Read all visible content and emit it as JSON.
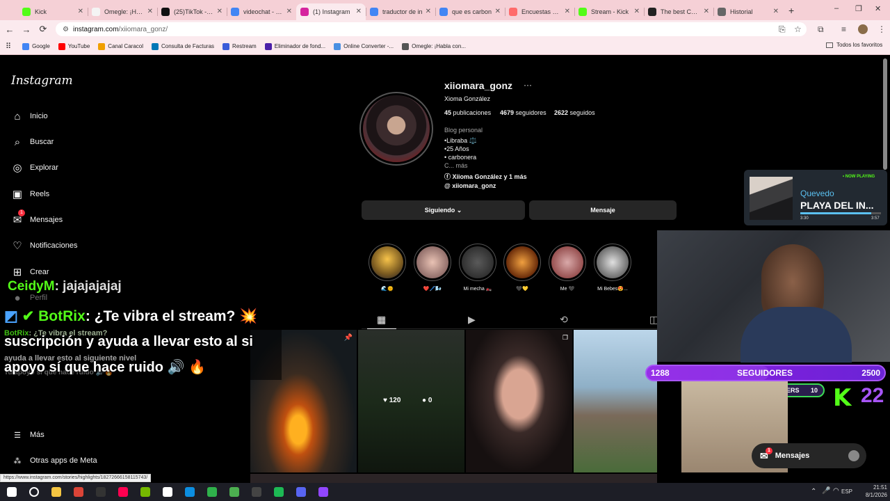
{
  "browser": {
    "tabs": [
      {
        "title": "Kick",
        "color": "#53fc18"
      },
      {
        "title": "Omegle: ¡Habla con",
        "color": "#f4f4f4"
      },
      {
        "title": "(25)TikTok - Ma",
        "color": "#111111"
      },
      {
        "title": "videochat - Bus",
        "color": "#4285f4"
      },
      {
        "title": "(1) Instagram",
        "color": "#d6249f",
        "active": true
      },
      {
        "title": "traductor de in",
        "color": "#4285f4"
      },
      {
        "title": "que es carbon",
        "color": "#4285f4"
      },
      {
        "title": "Encuestas en li",
        "color": "#ff6b6b"
      },
      {
        "title": "Stream - Kick",
        "color": "#53fc18"
      },
      {
        "title": "The best Chatb",
        "color": "#222222"
      },
      {
        "title": "Historial",
        "color": "#666666"
      }
    ],
    "new_tab": "+",
    "url_host": "instagram.com",
    "url_path": "/xiiomara_gonz/",
    "bookmarks": [
      {
        "label": "Google",
        "color": "#4285f4"
      },
      {
        "label": "YouTube",
        "color": "#ff0000"
      },
      {
        "label": "Canal Caracol",
        "color": "#f0a000"
      },
      {
        "label": "Consulta de Facturas",
        "color": "#0077b6"
      },
      {
        "label": "Restream",
        "color": "#3a5bd9"
      },
      {
        "label": "Eliminador de fond...",
        "color": "#4b1fa8"
      },
      {
        "label": "Online Converter -...",
        "color": "#4a90e2"
      },
      {
        "label": "Omegle: ¡Habla con...",
        "color": "#555555"
      }
    ],
    "all_bookmarks": "Todos los favoritos"
  },
  "instagram": {
    "logo": "Instagram",
    "nav": [
      {
        "label": "Inicio",
        "icon": "home-icon"
      },
      {
        "label": "Buscar",
        "icon": "search-icon"
      },
      {
        "label": "Explorar",
        "icon": "explore-icon"
      },
      {
        "label": "Reels",
        "icon": "reels-icon"
      },
      {
        "label": "Mensajes",
        "icon": "messenger-icon",
        "badge": "1"
      },
      {
        "label": "Notificaciones",
        "icon": "heart-icon"
      },
      {
        "label": "Crear",
        "icon": "plus-square-icon"
      },
      {
        "label": "Perfil",
        "icon": "avatar-icon"
      }
    ],
    "more": "Más",
    "meta": "Otras apps de Meta",
    "profile": {
      "username": "xiiomara_gonz",
      "full_name": "Xioma González",
      "posts_count": "45",
      "posts_label": "publicaciones",
      "followers_count": "4679",
      "followers_label": "seguidores",
      "following_count": "2622",
      "following_label": "seguidos",
      "category": "Blog personal",
      "bio": [
        "•Libraba ⚖️",
        "•25 Años",
        "• carbonera",
        "C... más"
      ],
      "link_facebook": "Xiioma González y 1 más",
      "link_threads": "xiiomara_gonz",
      "following_button": "Siguiendo",
      "message_button": "Mensaje"
    },
    "highlights": [
      {
        "label": "🌊🌞",
        "bg": "radial-gradient(circle at 50% 40%,#f7c34a,#7a5a20 60%,#1a1a2a)"
      },
      {
        "label": "❤️🖊️🌬️",
        "bg": "radial-gradient(circle,#e9c2b4,#6b4a4a)"
      },
      {
        "label": "Mi mecha 🏍️",
        "bg": "radial-gradient(circle,#5a5a5a,#1e1e1e)"
      },
      {
        "label": "🖤💛",
        "bg": "radial-gradient(circle,#f0a040,#6a2c0a 70%)"
      },
      {
        "label": "Me 🖤",
        "bg": "radial-gradient(circle,#d9a9a9,#7a2a2a)"
      },
      {
        "label": "Mi Bebes😍...",
        "bg": "radial-gradient(circle,#e0e0e0,#3a3a3a)"
      }
    ],
    "post_likes": "120",
    "post_comments": "0",
    "messages_pill": "Mensajes"
  },
  "stream": {
    "chat": [
      {
        "user": "CeidyM",
        "msg": ": jajajajajaj"
      },
      {
        "user": "BotRix",
        "msg": ": ¿Te vibra el stream? 💥"
      },
      {
        "line": "suscripción y ayuda a llevar esto al si"
      },
      {
        "line": "apoyo sí que hace ruido 🔊 🔥"
      }
    ],
    "chat_ghost": [
      {
        "user": "BotRix",
        "msg": ": ¿Te vibra el stream?"
      },
      {
        "line": "ayuda a llevar esto al siguiente nivel"
      },
      {
        "line": "Tu apoyo sí que hace ruido 🔊🔥"
      }
    ],
    "now_playing_tag": "• NOW PLAYING",
    "artist": "Quevedo",
    "song": "PLAYA DEL IN...",
    "elapsed": "3:30",
    "duration": "3:57",
    "progress": 0.88,
    "followers_current": "1288",
    "followers_label": "SEGUIDORES",
    "followers_goal": "2500",
    "followers_progress": 0.515,
    "subs_current": "0",
    "subs_label": "SUBSCRIBERS",
    "subs_goal": "10",
    "kick_count": "22"
  },
  "status_url": "https://www.instagram.com/stories/highlights/18272666158115743/",
  "taskbar": {
    "icons": [
      {
        "name": "windows-start-icon",
        "color": "#ffffff"
      },
      {
        "name": "search-icon",
        "color": "#ffffff"
      },
      {
        "name": "file-explorer-icon",
        "color": "#f5c542"
      },
      {
        "name": "chrome-icon",
        "color": "#db4437"
      },
      {
        "name": "cod-icon",
        "color": "#333333"
      },
      {
        "name": "tiktok-icon",
        "color": "#ff0050"
      },
      {
        "name": "nvidia-icon",
        "color": "#76b900"
      },
      {
        "name": "tf-icon",
        "color": "#ffffff"
      },
      {
        "name": "edge-icon",
        "color": "#0c8ee0"
      },
      {
        "name": "app-icon",
        "color": "#2fb14b"
      },
      {
        "name": "terminal-icon",
        "color": "#4caf50"
      },
      {
        "name": "obs-icon",
        "color": "#444444"
      },
      {
        "name": "spotify-icon",
        "color": "#1db954"
      },
      {
        "name": "discord-icon",
        "color": "#5865f2"
      },
      {
        "name": "twitch-icon",
        "color": "#9146ff"
      }
    ],
    "lang": "ESP",
    "time": "21:51",
    "date": "8/1/2026"
  }
}
